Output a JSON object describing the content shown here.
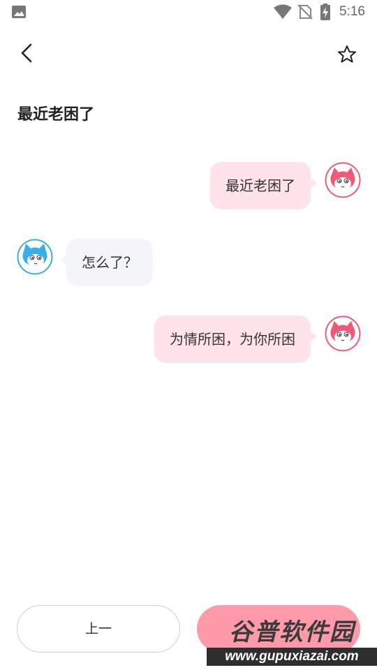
{
  "status_bar": {
    "time": "5:16",
    "icons": [
      "photo-icon",
      "wifi-icon",
      "no-sim-icon",
      "battery-charging-icon"
    ]
  },
  "toolbar": {
    "back_icon": "chevron-left-icon",
    "favorite_icon": "star-outline-icon"
  },
  "page": {
    "title": "最近老困了"
  },
  "messages": [
    {
      "side": "right",
      "text": "最近老困了",
      "avatar": "pink-cat-avatar"
    },
    {
      "side": "left",
      "text": "怎么了？",
      "avatar": "blue-cat-avatar"
    },
    {
      "side": "right",
      "text": "为情所困，为你所困",
      "avatar": "pink-cat-avatar"
    }
  ],
  "buttons": {
    "prev_label": "上一",
    "next_label": ""
  },
  "watermark": {
    "main": "谷普软件园",
    "url": "www.gupuxiazai.com"
  },
  "colors": {
    "bubble_right": "#ffe3ea",
    "bubble_left": "#f4f5f9",
    "next_button": "#ff9aaa",
    "pink_avatar": "#f05a78",
    "blue_avatar": "#3aaee8"
  }
}
